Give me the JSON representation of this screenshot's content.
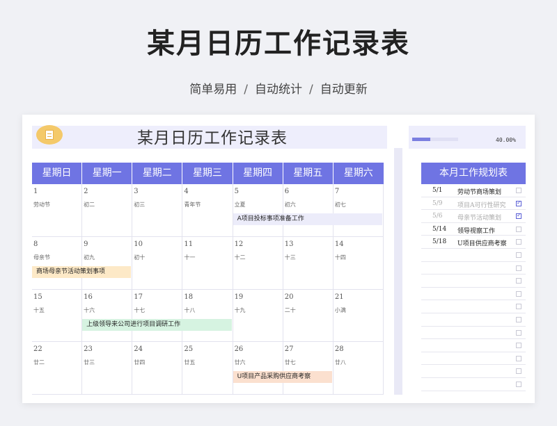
{
  "hero": {
    "title": "某月日历工作记录表",
    "sub1": "简单易用",
    "sub2": "自动统计",
    "sub3": "自动更新",
    "sep": "/"
  },
  "sheet": {
    "title": "某月日历工作记录表",
    "progress_text": "40.00%",
    "progress_fraction": 0.4
  },
  "weekdays": [
    "星期日",
    "星期一",
    "星期二",
    "星期三",
    "星期四",
    "星期五",
    "星期六"
  ],
  "days": [
    {
      "num": "1",
      "lunar": "劳动节"
    },
    {
      "num": "2",
      "lunar": "初二"
    },
    {
      "num": "3",
      "lunar": "初三"
    },
    {
      "num": "4",
      "lunar": "青年节"
    },
    {
      "num": "5",
      "lunar": "立夏"
    },
    {
      "num": "6",
      "lunar": "初六"
    },
    {
      "num": "7",
      "lunar": "初七"
    },
    {
      "num": "8",
      "lunar": "母亲节"
    },
    {
      "num": "9",
      "lunar": "初九"
    },
    {
      "num": "10",
      "lunar": "初十"
    },
    {
      "num": "11",
      "lunar": "十一"
    },
    {
      "num": "12",
      "lunar": "十二"
    },
    {
      "num": "13",
      "lunar": "十三"
    },
    {
      "num": "14",
      "lunar": "十四"
    },
    {
      "num": "15",
      "lunar": "十五"
    },
    {
      "num": "16",
      "lunar": "十六"
    },
    {
      "num": "17",
      "lunar": "十七"
    },
    {
      "num": "18",
      "lunar": "十八"
    },
    {
      "num": "19",
      "lunar": "十九"
    },
    {
      "num": "20",
      "lunar": "二十"
    },
    {
      "num": "21",
      "lunar": "小满"
    },
    {
      "num": "22",
      "lunar": "廿二"
    },
    {
      "num": "23",
      "lunar": "廿三"
    },
    {
      "num": "24",
      "lunar": "廿四"
    },
    {
      "num": "25",
      "lunar": "廿五"
    },
    {
      "num": "26",
      "lunar": "廿六"
    },
    {
      "num": "27",
      "lunar": "廿七"
    },
    {
      "num": "28",
      "lunar": "廿八"
    }
  ],
  "events": [
    {
      "label": "A项目投标事项准备工作",
      "color": "#ececfa"
    },
    {
      "label": "商场母亲节活动策划事项",
      "color": "#fde9c7"
    },
    {
      "label": "上级领导来公司进行项目调研工作",
      "color": "#d6f3e1"
    },
    {
      "label": "U项目产品采购供应商考察",
      "color": "#fbe0cf"
    }
  ],
  "plan": {
    "title": "本月工作规划表",
    "items": [
      {
        "date": "5/1",
        "task": "劳动节商场策划",
        "checked": false
      },
      {
        "date": "5/9",
        "task": "项目A可行性研究",
        "checked": true
      },
      {
        "date": "5/6",
        "task": "母亲节活动策划",
        "checked": true
      },
      {
        "date": "5/14",
        "task": "领导视察工作",
        "checked": false
      },
      {
        "date": "5/18",
        "task": "U项目供应商考察",
        "checked": false
      },
      {
        "date": "",
        "task": "",
        "checked": false
      },
      {
        "date": "",
        "task": "",
        "checked": false
      },
      {
        "date": "",
        "task": "",
        "checked": false
      },
      {
        "date": "",
        "task": "",
        "checked": false
      },
      {
        "date": "",
        "task": "",
        "checked": false
      },
      {
        "date": "",
        "task": "",
        "checked": false
      },
      {
        "date": "",
        "task": "",
        "checked": false
      },
      {
        "date": "",
        "task": "",
        "checked": false
      },
      {
        "date": "",
        "task": "",
        "checked": false
      },
      {
        "date": "",
        "task": "",
        "checked": false
      },
      {
        "date": "",
        "task": "",
        "checked": false
      }
    ]
  }
}
